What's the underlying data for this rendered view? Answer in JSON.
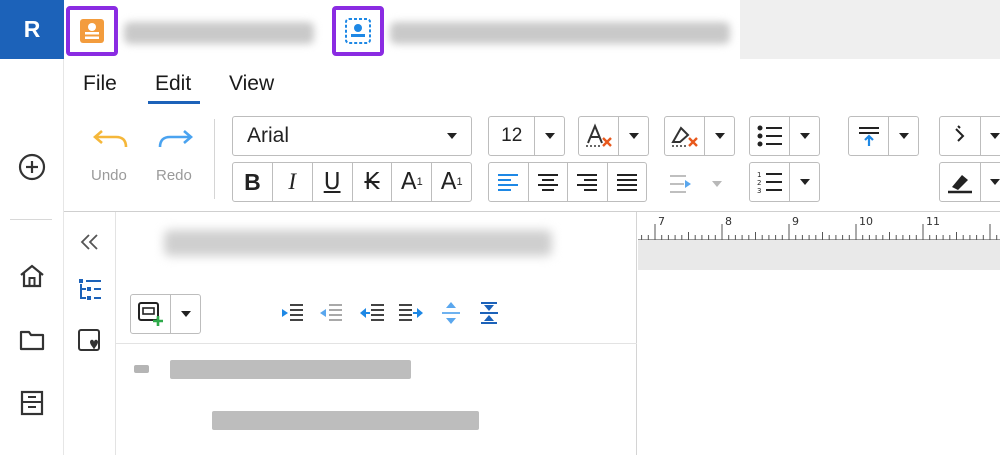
{
  "app": {
    "logo_letter": "R"
  },
  "menu": {
    "file": "File",
    "edit": "Edit",
    "view": "View"
  },
  "toolbar": {
    "undo_label": "Undo",
    "redo_label": "Redo",
    "font_family": "Arial",
    "font_size": "12",
    "bold": "B",
    "italic": "I",
    "underline": "U",
    "strikethrough": "K",
    "superscript": "A",
    "superscript_mark": "1",
    "subscript": "A",
    "subscript_mark": "1"
  },
  "ruler": {
    "ticks": [
      "7",
      "8",
      "9",
      "10",
      "11"
    ]
  },
  "colors": {
    "accent": "#1c62b9",
    "highlight": "#8a2be2",
    "icon_blue": "#1e88e5",
    "icon_orange": "#f5a623",
    "icon_red": "#e53935"
  },
  "icons": [
    "document-orange-icon",
    "document-blue-icon",
    "add-circle-icon",
    "home-icon",
    "folder-icon",
    "archive-icon",
    "undo-icon",
    "redo-icon",
    "clear-format-icon",
    "clear-style-icon",
    "bullet-list-icon",
    "numbered-list-icon",
    "paragraph-spacing-icon",
    "format-painter-icon",
    "highlight-icon",
    "collapse-icon",
    "outline-icon",
    "favorite-icon",
    "add-topic-icon",
    "indent-icon",
    "outdent-icon",
    "move-left-icon",
    "move-right-icon",
    "expand-icon",
    "compress-icon"
  ]
}
